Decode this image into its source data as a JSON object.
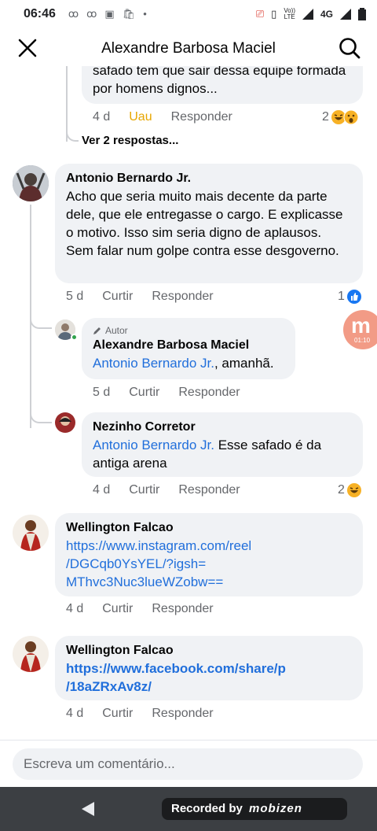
{
  "status_bar": {
    "time": "06:46",
    "volte_top": "Vo))",
    "volte_bottom": "LTE",
    "network": "4G"
  },
  "header": {
    "title": "Alexandre Barbosa Maciel"
  },
  "comments": {
    "top_fragment": {
      "text": "safado tem que sair dessa equipe formada por homens dignos...",
      "time": "4 d",
      "reaction_label": "Uau",
      "reply": "Responder",
      "count": "2",
      "see_replies": "Ver 2 respostas..."
    },
    "antonio": {
      "name": "Antonio Bernardo Jr.",
      "text": "Acho que seria muito mais decente da parte dele, que ele entregasse o cargo. E explicasse o motivo. Isso sim seria digno de aplausos. Sem falar num golpe contra esse desgoverno.",
      "time": "5 d",
      "like": "Curtir",
      "reply": "Responder",
      "count": "1"
    },
    "alexandre_reply": {
      "badge": "Autor",
      "name": "Alexandre Barbosa Maciel",
      "mention": "Antonio Bernardo Jr.",
      "text": ", amanhã.",
      "time": "5 d",
      "like": "Curtir",
      "reply": "Responder"
    },
    "nezinho_reply": {
      "name": "Nezinho Corretor",
      "mention": "Antonio Bernardo Jr.",
      "text": " Esse safado é da antiga arena",
      "time": "4 d",
      "like": "Curtir",
      "reply": "Responder",
      "count": "2"
    },
    "wellington1": {
      "name": "Wellington Falcao",
      "link": "https://www.instagram.com/reel/DGCqb0YsYEL/?igsh=MThvc3Nuc3lueWZobw==",
      "link_line1": "https://www.instagram.com/reel",
      "link_line2": "/DGCqb0YsYEL/?igsh=",
      "link_line3": "MThvc3Nuc3lueWZobw==",
      "time": "4 d",
      "like": "Curtir",
      "reply": "Responder"
    },
    "wellington2": {
      "name": "Wellington Falcao",
      "link_line1": "https://www.facebook.com/share/p",
      "link_line2": "/18aZRxAv8z/",
      "time": "4 d",
      "like": "Curtir",
      "reply": "Responder"
    }
  },
  "composer": {
    "placeholder": "Escreva um comentário..."
  },
  "overlay": {
    "mobizen_timer": "01:10",
    "recorded_by": "Recorded by",
    "brand": "mobizen"
  },
  "colors": {
    "link": "#216fdb",
    "wow": "#e7a600",
    "bubble": "#f0f2f5"
  }
}
